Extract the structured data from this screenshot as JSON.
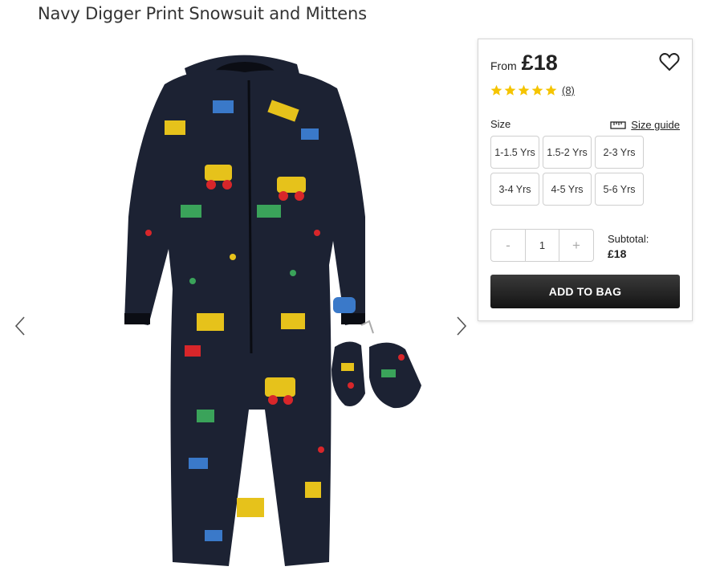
{
  "product": {
    "title": "Navy Digger Print Snowsuit and Mittens"
  },
  "gallery": {
    "prev_icon": "chevron-left-icon",
    "next_icon": "chevron-right-icon",
    "image": "snowsuit-and-mittens-image"
  },
  "purchase": {
    "from_label": "From",
    "price": "£18",
    "wishlist_icon": "heart-icon",
    "rating": 5,
    "review_count": "(8)",
    "size_label": "Size",
    "size_guide_label": "Size guide",
    "sizes": [
      "1-1.5 Yrs",
      "1.5-2 Yrs",
      "2-3 Yrs",
      "3-4 Yrs",
      "4-5 Yrs",
      "5-6 Yrs"
    ],
    "quantity": {
      "minus": "-",
      "value": "1",
      "plus": "+"
    },
    "subtotal_label": "Subtotal:",
    "subtotal_value": "£18",
    "add_to_bag_label": "ADD TO BAG"
  },
  "colors": {
    "star": "#f5c400",
    "button_dark": "#1f1f1f",
    "suit_navy": "#1c2233"
  }
}
